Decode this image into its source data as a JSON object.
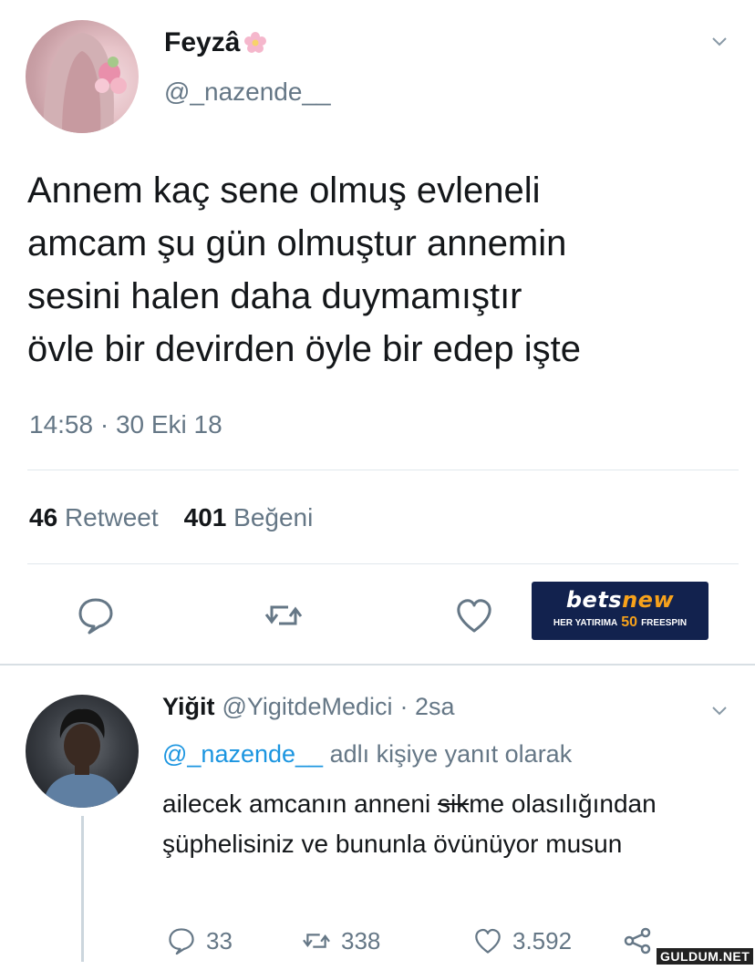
{
  "tweet": {
    "display_name": "Feyzâ",
    "name_emoji_icon": "flower-emoji-icon",
    "handle": "@_nazende__",
    "text": "Annem kaç sene olmuş evleneli\namcam şu gün olmuştur annemin\nsesini halen daha duymamıştır\növle bir devirden öyle bir edep işte",
    "timestamp": "14:58 · 30 Eki 18",
    "retweets_count": "46",
    "retweets_label": "Retweet",
    "likes_count": "401",
    "likes_label": "Beğeni",
    "icons": [
      "reply-icon",
      "retweet-icon",
      "heart-icon",
      "chevron-down-icon"
    ]
  },
  "ad": {
    "brand_part1": "bets",
    "brand_part2": "new",
    "tagline_pre": "HER YATIRIMA",
    "tagline_number": "50",
    "tagline_post": "FREESPIN",
    "colors": {
      "background": "#12224e",
      "accent": "#f7a21b"
    }
  },
  "reply": {
    "display_name": "Yiğit",
    "handle": "@YigitdeMedici",
    "time": "· 2sa",
    "replying_mention": "@_nazende__",
    "replying_suffix": "adlı kişiye yanıt olarak",
    "text_pre": "ailecek amcanın anneni ",
    "text_strike": "sik",
    "text_post": "me olasılığından şüphelisiniz ve bununla övünüyor musun",
    "reply_count": "33",
    "retweet_count": "338",
    "like_count": "3.592",
    "icons": [
      "reply-icon",
      "retweet-icon",
      "heart-icon",
      "share-icon",
      "chevron-down-icon"
    ]
  },
  "watermark": "GULDUM.NET",
  "colors": {
    "text": "#14171a",
    "secondary": "#657786",
    "link": "#1b95e0",
    "divider": "#e1e8ed"
  }
}
